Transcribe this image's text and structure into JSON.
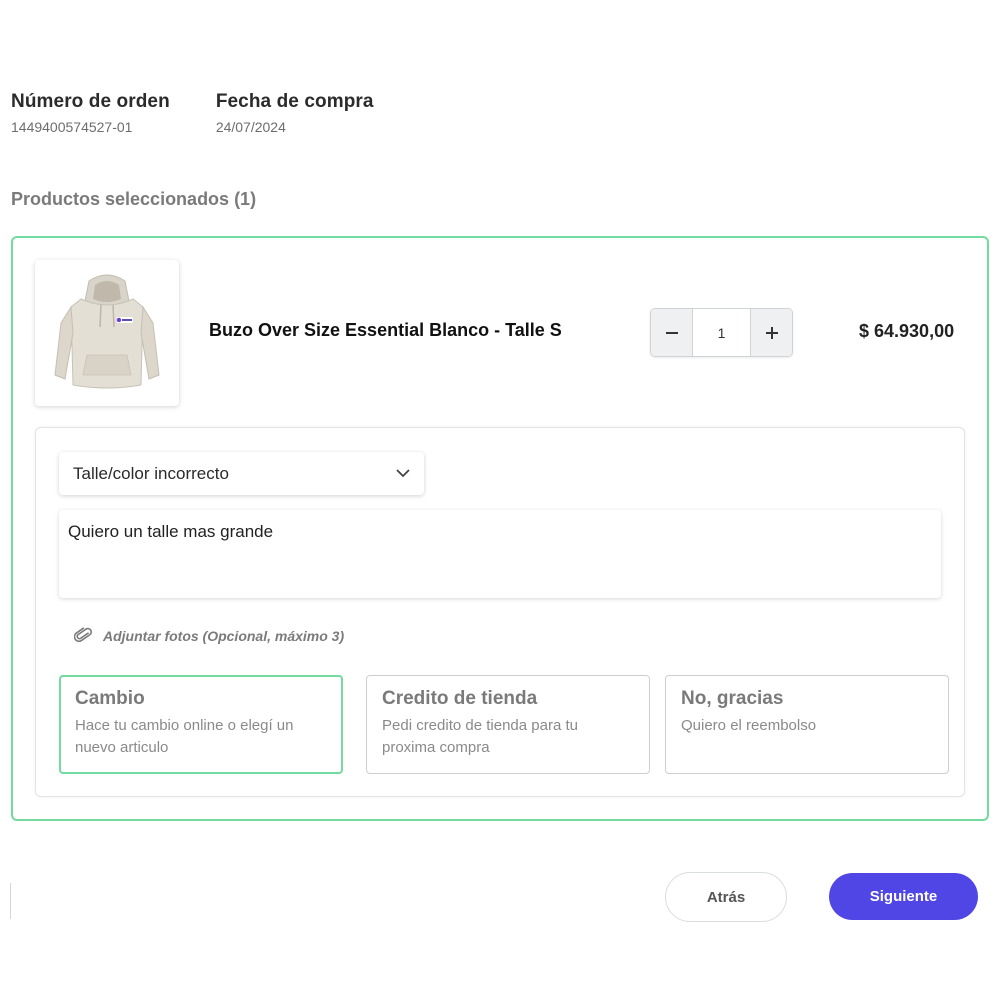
{
  "order": {
    "number_label": "Número de orden",
    "number_value": "1449400574527-01",
    "date_label": "Fecha de compra",
    "date_value": "24/07/2024"
  },
  "products": {
    "section_title": "Productos seleccionados (1)",
    "item": {
      "name": "Buzo Over Size Essential Blanco - Talle S",
      "image_icon": "hoodie-product-image",
      "quantity": "1",
      "minus_label": "−",
      "plus_label": "+",
      "price": "$ 64.930,00"
    }
  },
  "return_form": {
    "reason_selected": "Talle/color incorrecto",
    "comment_value": "Quiero un talle mas grande",
    "attach_label": "Adjuntar fotos (Opcional, máximo 3)",
    "options": [
      {
        "title": "Cambio",
        "description": "Hace tu cambio online o elegí un nuevo articulo",
        "selected": true
      },
      {
        "title": "Credito de tienda",
        "description": "Pedi credito de tienda para tu proxima compra",
        "selected": false
      },
      {
        "title": "No, gracias",
        "description": "Quiero el reembolso",
        "selected": false
      }
    ]
  },
  "footer": {
    "back_label": "Atrás",
    "next_label": "Siguiente"
  },
  "colors": {
    "accent_green": "#74dba0",
    "primary_button": "#4f46e5"
  }
}
